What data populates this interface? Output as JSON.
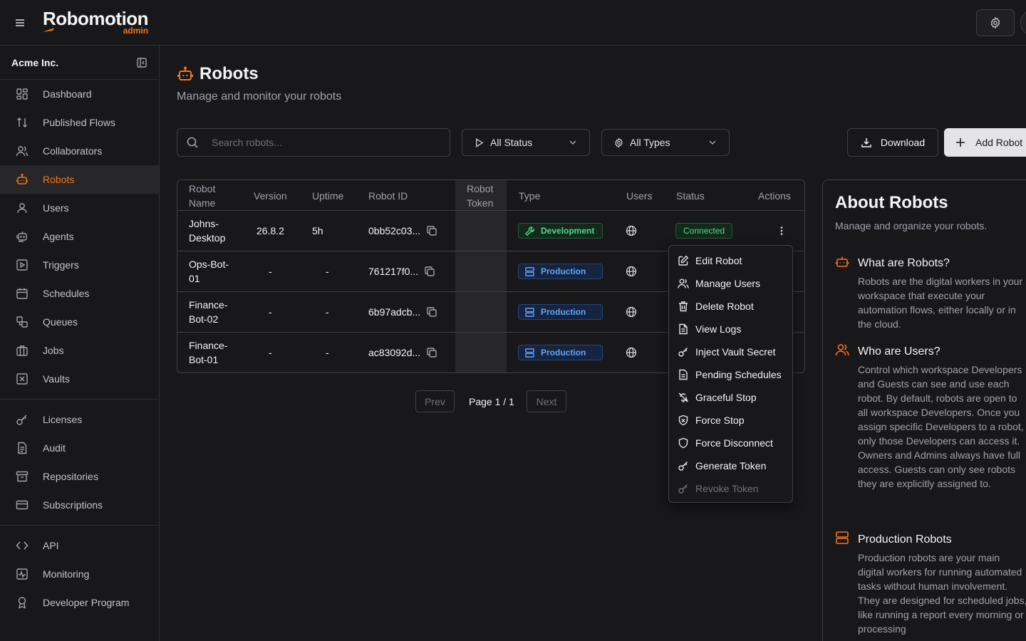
{
  "brand": {
    "name": "Robomotion",
    "sub": "admin",
    "accent": "#f97316"
  },
  "org": {
    "name": "Acme Inc."
  },
  "sidebar": {
    "group1": [
      {
        "label": "Dashboard",
        "icon": "dashboard-icon"
      },
      {
        "label": "Published Flows",
        "icon": "arrows-updown-icon"
      },
      {
        "label": "Collaborators",
        "icon": "users-group-icon"
      },
      {
        "label": "Robots",
        "icon": "robot-icon",
        "active": true
      },
      {
        "label": "Users",
        "icon": "user-icon"
      },
      {
        "label": "Agents",
        "icon": "agent-icon"
      },
      {
        "label": "Triggers",
        "icon": "trigger-icon"
      },
      {
        "label": "Schedules",
        "icon": "calendar-icon"
      },
      {
        "label": "Queues",
        "icon": "queue-icon"
      },
      {
        "label": "Jobs",
        "icon": "briefcase-icon"
      },
      {
        "label": "Vaults",
        "icon": "vault-icon"
      }
    ],
    "group2": [
      {
        "label": "Licenses",
        "icon": "key-icon"
      },
      {
        "label": "Audit",
        "icon": "document-icon"
      },
      {
        "label": "Repositories",
        "icon": "archive-icon"
      },
      {
        "label": "Subscriptions",
        "icon": "card-icon"
      }
    ],
    "group3": [
      {
        "label": "API",
        "icon": "code-icon"
      },
      {
        "label": "Monitoring",
        "icon": "monitor-icon"
      },
      {
        "label": "Developer Program",
        "icon": "award-icon"
      }
    ]
  },
  "page": {
    "title": "Robots",
    "subtitle": "Manage and monitor your robots"
  },
  "toolbar": {
    "search_placeholder": "Search robots...",
    "status_filter": "All Status",
    "type_filter": "All Types",
    "download_label": "Download",
    "add_label": "Add Robot"
  },
  "table": {
    "headers": {
      "name": "Robot Name",
      "version": "Version",
      "uptime": "Uptime",
      "robot_id": "Robot ID",
      "token": "Robot Token",
      "type": "Type",
      "users": "Users",
      "status": "Status",
      "actions": "Actions"
    },
    "rows": [
      {
        "name": "Johns-Desktop",
        "version": "26.8.2",
        "uptime": "5h",
        "robot_id": "0bb52c03...",
        "type": "Development",
        "status": "Connected"
      },
      {
        "name": "Ops-Bot-01",
        "version": "-",
        "uptime": "-",
        "robot_id": "761217f0...",
        "type": "Production",
        "status": ""
      },
      {
        "name": "Finance-Bot-02",
        "version": "-",
        "uptime": "-",
        "robot_id": "6b97adcb...",
        "type": "Production",
        "status": ""
      },
      {
        "name": "Finance-Bot-01",
        "version": "-",
        "uptime": "-",
        "robot_id": "ac83092d...",
        "type": "Production",
        "status": ""
      }
    ]
  },
  "pagination": {
    "prev": "Prev",
    "page": "Page 1 / 1",
    "next": "Next"
  },
  "menu": [
    {
      "label": "Edit Robot",
      "icon": "edit-icon"
    },
    {
      "label": "Manage Users",
      "icon": "users-icon"
    },
    {
      "label": "Delete Robot",
      "icon": "trash-icon"
    },
    {
      "label": "View Logs",
      "icon": "file-text-icon"
    },
    {
      "label": "Inject Vault Secret",
      "icon": "key-icon"
    },
    {
      "label": "Pending Schedules",
      "icon": "file-icon"
    },
    {
      "label": "Graceful Stop",
      "icon": "bell-off-icon"
    },
    {
      "label": "Force Stop",
      "icon": "shield-x-icon"
    },
    {
      "label": "Force Disconnect",
      "icon": "shield-icon"
    },
    {
      "label": "Generate Token",
      "icon": "key-icon"
    },
    {
      "label": "Revoke Token",
      "icon": "key-icon",
      "disabled": true
    }
  ],
  "about": {
    "title": "About Robots",
    "subtitle": "Manage and organize your robots.",
    "sections": [
      {
        "title": "What are Robots?",
        "icon": "robot-icon",
        "body": "Robots are the digital workers in your workspace that execute your automation flows, either locally or in the cloud."
      },
      {
        "title": "Who are Users?",
        "icon": "users-icon",
        "body": "Control which workspace Developers and Guests can see and use each robot. By default, robots are open to all workspace Developers. Once you assign specific Developers to a robot, only those Developers can access it. Owners and Admins always have full access. Guests can only see robots they are explicitly assigned to."
      },
      {
        "title": "Production Robots",
        "icon": "server-icon",
        "body": "Production robots are your main digital workers for running automated tasks without human involvement. They are designed for scheduled jobs, like running a report every morning or processing"
      }
    ]
  }
}
